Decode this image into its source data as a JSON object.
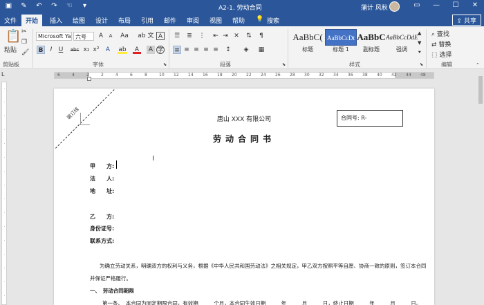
{
  "titlebar": {
    "doc_title": "A2-1. 劳动合同",
    "user_name": "蒲计 风秋",
    "quick_access": [
      "save-icon",
      "brush-icon",
      "undo-icon",
      "redo-icon",
      "touch-icon",
      "more-icon"
    ],
    "window_buttons": [
      "ribbon-options-icon",
      "minimize-icon",
      "restore-icon",
      "close-icon"
    ]
  },
  "tabs": {
    "file": "文件",
    "items": [
      "开始",
      "插入",
      "绘图",
      "设计",
      "布局",
      "引用",
      "邮件",
      "审阅",
      "视图",
      "帮助"
    ],
    "search": "搜索",
    "share": "共享"
  },
  "ribbon": {
    "clipboard": {
      "label": "剪贴板",
      "paste": "粘贴"
    },
    "font": {
      "label": "字体",
      "font_name": "Microsoft Ya",
      "font_size": "六号",
      "buttons": [
        "A",
        "A",
        "Aa",
        "ab",
        "文",
        "A",
        "B",
        "I",
        "U",
        "abc",
        "x₂",
        "x²",
        "A",
        "ab",
        "A",
        "A",
        "字"
      ]
    },
    "paragraph": {
      "label": "段落"
    },
    "styles": {
      "label": "样式",
      "items": [
        {
          "preview": "AaBbC(",
          "name": "标题"
        },
        {
          "preview": "AaBbCcDt",
          "name": "标题 1"
        },
        {
          "preview": "AaBbC",
          "name": "副标题"
        },
        {
          "preview": "AaBbCcDdE",
          "name": "强调"
        }
      ]
    },
    "editing": {
      "label": "编辑",
      "find": "查找",
      "replace": "替换",
      "select": "选择"
    }
  },
  "ruler": {
    "ticks": [
      "6",
      "4",
      "2",
      "2",
      "4",
      "6",
      "8",
      "10",
      "12",
      "14",
      "16",
      "18",
      "20",
      "22",
      "24",
      "26",
      "28",
      "30",
      "32",
      "34",
      "36",
      "38",
      "40",
      "42",
      "44",
      "48"
    ]
  },
  "document": {
    "binding_label": "装订线",
    "company": "唐山 XXX 有限公司",
    "contract_no": "合同号:  R-",
    "heading": "劳动合同书",
    "party_a": "甲　　方:",
    "legal_rep": "法　　人:",
    "address": "地　　址:",
    "party_b": "乙　　方:",
    "id_no": "身份证号:",
    "contact": "联系方式:",
    "intro_1": "为确立劳动关系，明确双方的权利与义务，根据《中华人民共和国劳动法》之相关规定，甲乙双方按照平等自愿、协商一致的原则，签订本合同",
    "intro_2": "并保证严格履行。",
    "section_1": "一、　劳动合同期限",
    "article_1": "第一条、　本合同为固定期限合同，有效期　　　个月，本合同生效日期　　　年　　　月　　　日，终止日期　　　年　　　月　　　日。"
  }
}
